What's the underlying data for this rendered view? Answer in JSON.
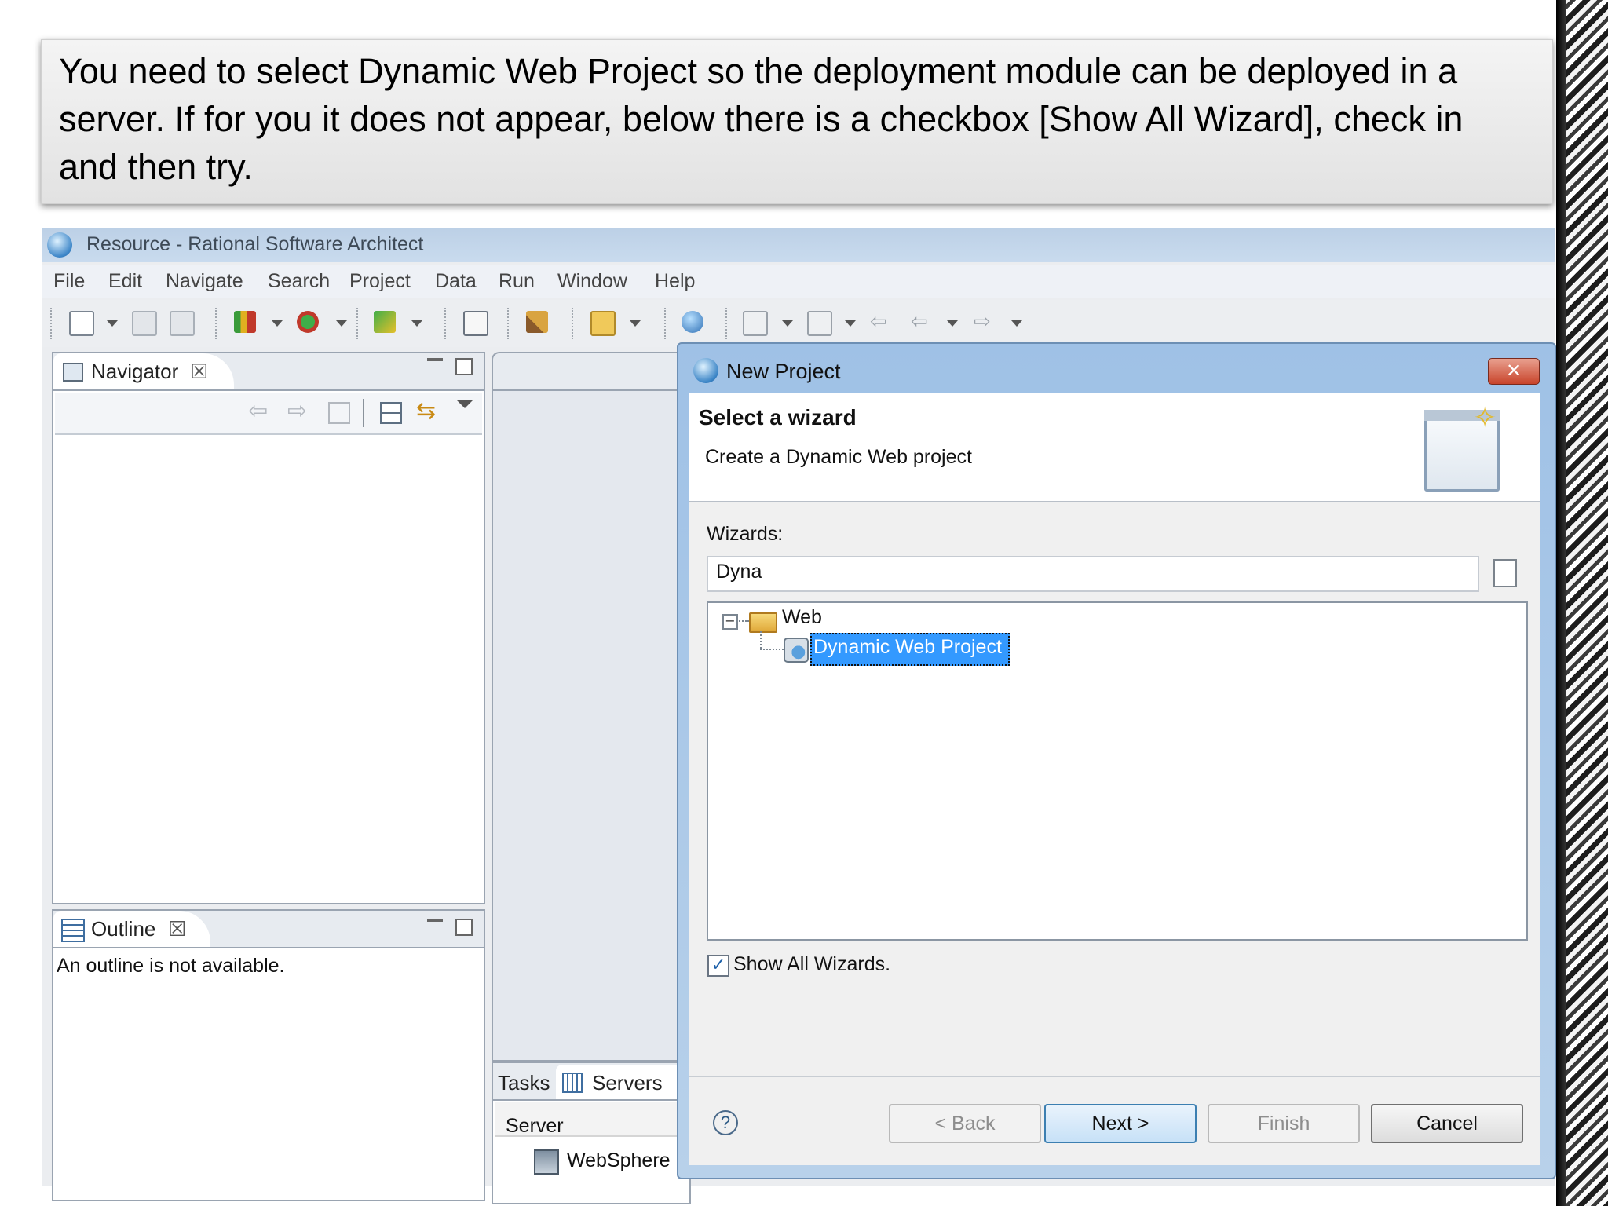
{
  "caption": {
    "line1": "You need to select Dynamic Web Project so the deployment module can be deployed in a",
    "line2": "server. If for you it does not appear, below there is a checkbox [Show All Wizard], check in",
    "line3": "and then try."
  },
  "window": {
    "title": "Resource - Rational Software Architect"
  },
  "menu": [
    "File",
    "Edit",
    "Navigate",
    "Search",
    "Project",
    "Data",
    "Run",
    "Window",
    "Help"
  ],
  "navigator": {
    "tab_label": "Navigator",
    "close_glyph": "☒"
  },
  "outline": {
    "tab_label": "Outline",
    "close_glyph": "☒",
    "message": "An outline is not available."
  },
  "bottom_views": {
    "tasks_tab": "Tasks",
    "servers_tab": "Servers",
    "column_header": "Server",
    "row_text": "WebSphere"
  },
  "dialog": {
    "title": "New Project",
    "close_glyph": "✕",
    "heading": "Select a wizard",
    "subheading": "Create a Dynamic Web project",
    "wizards_label": "Wizards:",
    "filter_value": "Dyna",
    "tree": {
      "folder": "Web",
      "item": "Dynamic Web Project",
      "expander": "−"
    },
    "show_all": {
      "label": "Show All Wizards.",
      "checked": true,
      "check_glyph": "✓"
    },
    "help_glyph": "?",
    "buttons": {
      "back": "< Back",
      "next": "Next >",
      "finish": "Finish",
      "cancel": "Cancel"
    }
  },
  "colors": {
    "selection": "#3399ff",
    "dialog_frame": "#9fc1e6",
    "close_button": "#c8442b"
  }
}
